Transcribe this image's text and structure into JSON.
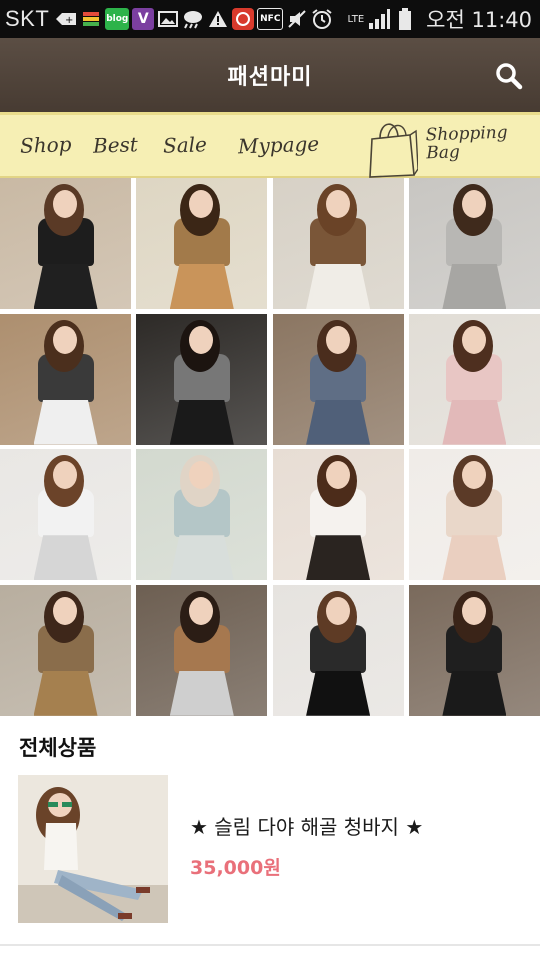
{
  "status_bar": {
    "carrier": "SKT",
    "network": "LTE",
    "time": "오전 11:40",
    "icons": [
      "usb-debug-icon",
      "sim-icon",
      "blog-app-icon",
      "v-app-icon",
      "image-icon",
      "weather-icon",
      "warning-icon",
      "app-icon",
      "nfc-icon",
      "mute-icon",
      "alarm-icon",
      "signal-icon",
      "battery-icon"
    ]
  },
  "header": {
    "title": "패션마미",
    "search_icon": "search-icon"
  },
  "nav": {
    "items": [
      {
        "label": "Shop"
      },
      {
        "label": "Best"
      },
      {
        "label": "Sale"
      },
      {
        "label": "Mypage"
      }
    ],
    "bag_label_1": "Shopping",
    "bag_label_2": "Bag",
    "bag_icon": "shopping-bag-icon"
  },
  "grid": {
    "tiles": [
      {
        "bg": "#c9b9a4",
        "top": "#1d1d1d",
        "bottom": "#202020",
        "hair": "#5a3a26"
      },
      {
        "bg": "#ded6c3",
        "top": "#a27a4a",
        "bottom": "#c9945a",
        "hair": "#3b2616"
      },
      {
        "bg": "#d7d1c6",
        "top": "#7a5638",
        "bottom": "#f0ede7",
        "hair": "#6a4327"
      },
      {
        "bg": "#c8c6c2",
        "top": "#b8b7b4",
        "bottom": "#a7a6a3",
        "hair": "#3f2a1c"
      },
      {
        "bg": "#ad8f6f",
        "top": "#3a3a3a",
        "bottom": "#efefef",
        "hair": "#4b2f1d"
      },
      {
        "bg": "#2d2a27",
        "top": "#777777",
        "bottom": "#1a1a1a",
        "hair": "#1c1410"
      },
      {
        "bg": "#8b7662",
        "top": "#5f6e85",
        "bottom": "#506079",
        "hair": "#4a2d1d"
      },
      {
        "bg": "#e1ddd6",
        "top": "#e8c6c4",
        "bottom": "#e2b9b9",
        "hair": "#4e2f1f"
      },
      {
        "bg": "#e9e7e4",
        "top": "#f2f2f2",
        "bottom": "#d6d6d6",
        "hair": "#6b4329"
      },
      {
        "bg": "#d3d9cf",
        "top": "#b4c6c7",
        "bottom": "#d8dedb",
        "hair": "#e0d4c6"
      },
      {
        "bg": "#e7ddd4",
        "top": "#f5f2ee",
        "bottom": "#2a2420",
        "hair": "#4c2c1a"
      },
      {
        "bg": "#f0ece8",
        "top": "#e9d7c9",
        "bottom": "#eacfc0",
        "hair": "#5b3a27"
      },
      {
        "bg": "#b8ae9f",
        "top": "#8a6d4b",
        "bottom": "#a5804f",
        "hair": "#3e271a"
      },
      {
        "bg": "#6d5f52",
        "top": "#a6784f",
        "bottom": "#cfcfcf",
        "hair": "#2b1d15"
      },
      {
        "bg": "#e6e3df",
        "top": "#2a2a2a",
        "bottom": "#111111",
        "hair": "#5e3b25"
      },
      {
        "bg": "#7a6a5c",
        "top": "#1f1f1f",
        "bottom": "#1a1a1a",
        "hair": "#3a2418"
      }
    ]
  },
  "section": {
    "title": "전체상품"
  },
  "products": [
    {
      "name": "★ 슬림 다야 해골 청바지 ★",
      "price": "35,000원"
    }
  ],
  "colors": {
    "header_bg": "#4f4238",
    "nav_bg": "#f6efb4",
    "price": "#e9707a"
  }
}
